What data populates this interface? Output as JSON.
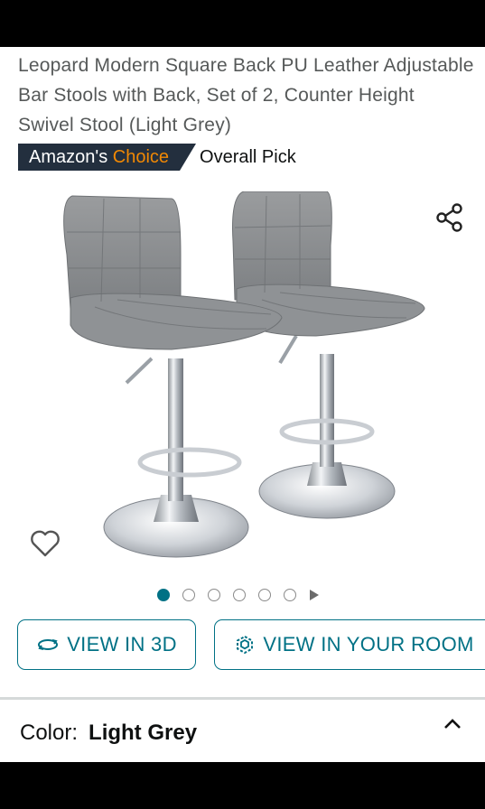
{
  "product": {
    "title": "Leopard Modern Square Back PU Leather Adjustable Bar Stools with Back, Set of 2, Counter Height Swivel Stool (Light Grey)",
    "badge_prefix": "Amazon's ",
    "badge_highlight": "Choice",
    "badge_suffix": "Overall Pick"
  },
  "image": {
    "alt": "",
    "carousel_total_dots": 6,
    "active_index": 0
  },
  "icons": {
    "share": "share-icon",
    "favorite": "heart-icon",
    "view_3d": "rotate-3d-icon",
    "view_room": "cube-ar-icon",
    "collapse": "chevron-up-icon",
    "carousel_next": "play-triangle-icon"
  },
  "actions": {
    "view_3d_label": "VIEW IN 3D",
    "view_room_label": "VIEW IN YOUR ROOM"
  },
  "variation": {
    "label": "Color:",
    "value": "Light Grey"
  },
  "colors": {
    "accent": "#007185",
    "badge_bg": "#232f3e",
    "badge_orange": "#f08804",
    "title_text": "#565959"
  }
}
